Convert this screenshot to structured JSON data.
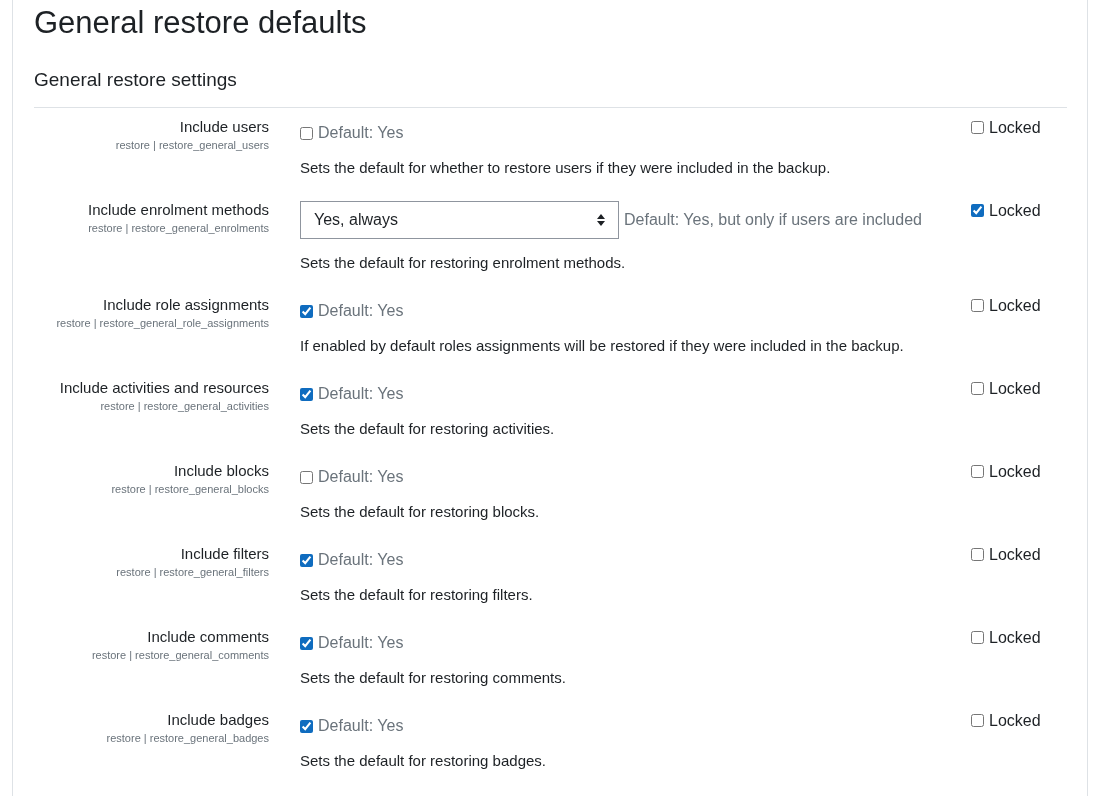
{
  "page_title": "General restore defaults",
  "section_title": "General restore settings",
  "settings": [
    {
      "kind": "checkbox",
      "label": "Include users",
      "key": "restore | restore_general_users",
      "checked": false,
      "default": "Default: Yes",
      "description": "Sets the default for whether to restore users if they were included in the backup.",
      "locked": false,
      "locked_label": "Locked"
    },
    {
      "kind": "select",
      "label": "Include enrolment methods",
      "key": "restore | restore_general_enrolments",
      "value": "Yes, always",
      "default": "Default: Yes, but only if users are included",
      "description": "Sets the default for restoring enrolment methods.",
      "locked": true,
      "locked_label": "Locked"
    },
    {
      "kind": "checkbox",
      "label": "Include role assignments",
      "key": "restore | restore_general_role_assignments",
      "checked": true,
      "default": "Default: Yes",
      "description": "If enabled by default roles assignments will be restored if they were included in the backup.",
      "locked": false,
      "locked_label": "Locked"
    },
    {
      "kind": "checkbox",
      "label": "Include activities and resources",
      "key": "restore | restore_general_activities",
      "checked": true,
      "default": "Default: Yes",
      "description": "Sets the default for restoring activities.",
      "locked": false,
      "locked_label": "Locked"
    },
    {
      "kind": "checkbox",
      "label": "Include blocks",
      "key": "restore | restore_general_blocks",
      "checked": false,
      "default": "Default: Yes",
      "description": "Sets the default for restoring blocks.",
      "locked": false,
      "locked_label": "Locked"
    },
    {
      "kind": "checkbox",
      "label": "Include filters",
      "key": "restore | restore_general_filters",
      "checked": true,
      "default": "Default: Yes",
      "description": "Sets the default for restoring filters.",
      "locked": false,
      "locked_label": "Locked"
    },
    {
      "kind": "checkbox",
      "label": "Include comments",
      "key": "restore | restore_general_comments",
      "checked": true,
      "default": "Default: Yes",
      "description": "Sets the default for restoring comments.",
      "locked": false,
      "locked_label": "Locked"
    },
    {
      "kind": "checkbox",
      "label": "Include badges",
      "key": "restore | restore_general_badges",
      "checked": true,
      "default": "Default: Yes",
      "description": "Sets the default for restoring badges.",
      "locked": false,
      "locked_label": "Locked"
    }
  ]
}
